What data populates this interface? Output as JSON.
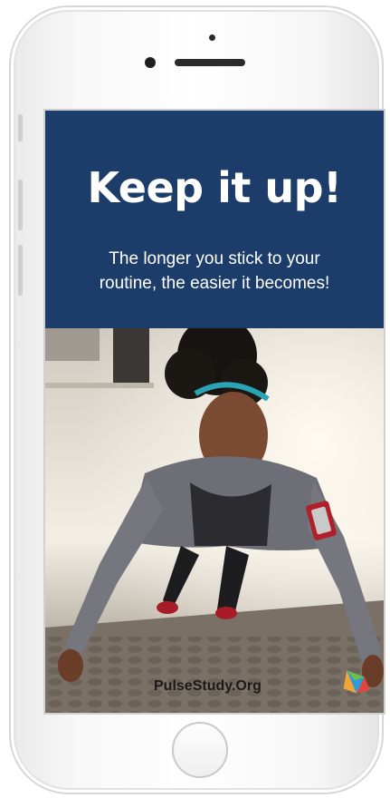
{
  "screen": {
    "headline": "Keep it up!",
    "subtext_line1": "The longer you stick to your",
    "subtext_line2": "routine, the easier it becomes!",
    "watermark": "PulseStudy.Org"
  },
  "colors": {
    "banner_bg": "#1c3d6a",
    "text": "#ffffff"
  },
  "icons": {
    "logo": "pulsestudy-logo-icon"
  }
}
